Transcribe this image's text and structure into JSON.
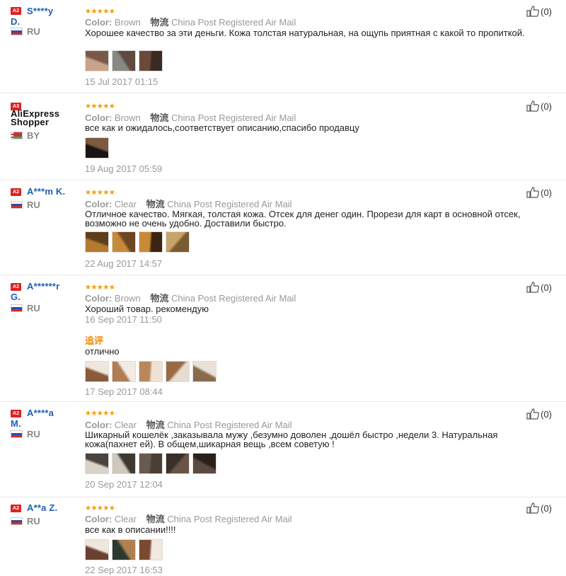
{
  "reviews": [
    {
      "level": "A2",
      "name": "S****y\nD.",
      "country": "RU",
      "flag": "ru",
      "stars": "★★★★★",
      "star_dot": "·",
      "color_label": "Color:",
      "color_value": "Brown",
      "ship_label": "物流",
      "ship_value": "China Post Registered Air Mail",
      "text": "Хорошее качество за эти деньги. Кожа толстая натуральная, на ощупь приятная с какой то пропиткой.",
      "date": "15 Jul 2017 01:15",
      "likes": "(0)",
      "thumbs": [
        [
          "#c9a48a",
          "#7a5a47"
        ],
        [
          "#8a8884",
          "#5e4a3e"
        ],
        [
          "#6b4a3a",
          "#3a2a22"
        ]
      ]
    },
    {
      "level": "A3",
      "name": "AliExpress\nShopper",
      "country": "BY",
      "flag": "by",
      "stars": "★★★★★",
      "star_dot": "·",
      "color_label": "Color:",
      "color_value": "Brown",
      "ship_label": "物流",
      "ship_value": "China Post Registered Air Mail",
      "text": "все как и ожидалось,соответствует описанию,спасибо продавцу",
      "date": "19 Aug 2017 05:59",
      "likes": "(0)",
      "thumbs": [
        [
          "#1a1412",
          "#7b5a40"
        ]
      ]
    },
    {
      "level": "A2",
      "name": "A***m K.",
      "country": "RU",
      "flag": "ru",
      "stars": "★★★★★",
      "star_dot": "·",
      "color_label": "Color:",
      "color_value": "Clear",
      "ship_label": "物流",
      "ship_value": "China Post Registered Air Mail",
      "text": "Отличное качество. Мягкая, толстая кожа. Отсек для денег один. Прорези для карт в основной отсек, возможно не очень удобно. Доставили быстро.",
      "date": "22 Aug 2017 14:57",
      "likes": "(0)",
      "thumbs": [
        [
          "#b47a30",
          "#5e3d1a"
        ],
        [
          "#c68b3a",
          "#6d4520"
        ],
        [
          "#c98a36",
          "#3b2410"
        ],
        [
          "#caa36a",
          "#7a5a30"
        ]
      ]
    },
    {
      "level": "A2",
      "name": "A******r\nG.",
      "country": "RU",
      "flag": "ru",
      "stars": "★★★★★",
      "star_dot": "·",
      "color_label": "Color:",
      "color_value": "Brown",
      "ship_label": "物流",
      "ship_value": "China Post Registered Air Mail",
      "text": "Хороший товар. рекомендую",
      "date": "16 Sep 2017 11:50",
      "addon_label": "追评",
      "addon_text": "отлично",
      "addon_date": "17 Sep 2017 08:44",
      "likes": "(0)",
      "thumbs": [
        [
          "#8a5a3a",
          "#efe6dc"
        ],
        [
          "#b07c52",
          "#f2ebe3"
        ],
        [
          "#b9875c",
          "#efe2d3"
        ],
        [
          "#9a6a44",
          "#e8dccf"
        ],
        [
          "#8a6a4c",
          "#e9e0d6"
        ]
      ]
    },
    {
      "level": "A2",
      "name": "A****a\nM.",
      "country": "RU",
      "flag": "ru",
      "stars": "★★★★★",
      "star_dot": "·",
      "color_label": "Color:",
      "color_value": "Clear",
      "ship_label": "物流",
      "ship_value": "China Post Registered Air Mail",
      "text": "Шикарный кошелёк ,заказывала мужу ,безумно доволен ,дошёл быстро ,недели 3. Натуральная кожа(пахнет ей). В общем,шикарная вещь ,всем советую !",
      "date": "20 Sep 2017 12:04",
      "likes": "(0)",
      "thumbs": [
        [
          "#d8d2c8",
          "#4a4440"
        ],
        [
          "#cfc8bd",
          "#3e3833"
        ],
        [
          "#6a5a50",
          "#4a3e36"
        ],
        [
          "#3a2e28",
          "#6a5448"
        ],
        [
          "#5a4a40",
          "#2a201a"
        ]
      ]
    },
    {
      "level": "A2",
      "name": "A**a Z.",
      "country": "RU",
      "flag": "ru",
      "stars": "★★★★★",
      "star_dot": "·",
      "color_label": "Color:",
      "color_value": "Clear",
      "ship_label": "物流",
      "ship_value": "China Post Registered Air Mail",
      "text": "все как в описании!!!!",
      "date": "22 Sep 2017 16:53",
      "likes": "(0)",
      "thumbs": [
        [
          "#6a4030",
          "#efe6dc"
        ],
        [
          "#2a3a30",
          "#b08050"
        ],
        [
          "#7a4a30",
          "#f1e9e0"
        ]
      ]
    }
  ]
}
